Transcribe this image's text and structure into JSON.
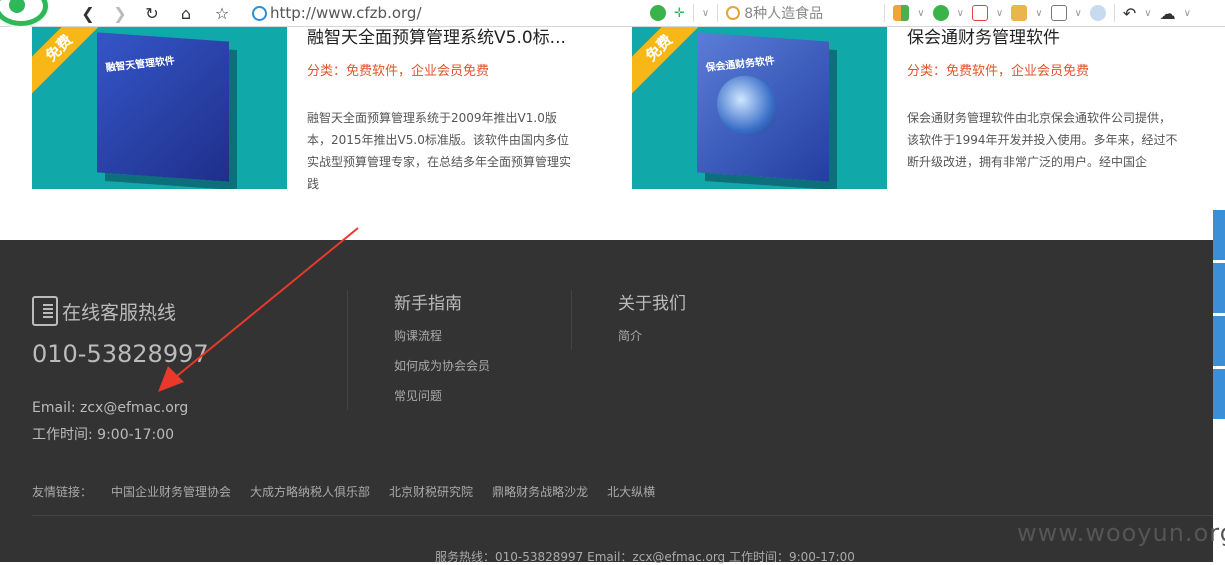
{
  "browser": {
    "url": "http://www.cfzb.org/",
    "search_text": "8种人造食品",
    "icons": [
      "back-icon",
      "forward-icon",
      "refresh-icon",
      "home-icon",
      "star-icon",
      "globe-icon",
      "extension-icon",
      "shield-icon",
      "pdf-icon",
      "translate-icon",
      "image-icon",
      "search-tool-icon",
      "undo-icon",
      "cloud-icon"
    ]
  },
  "products": [
    {
      "badge": "免费",
      "book_title": "融智天管理软件",
      "title": "融智天全面预算管理系统V5.0标...",
      "category": "分类：免费软件，企业会员免费",
      "description": "融智天全面预算管理系统于2009年推出V1.0版本，2015年推出V5.0标准版。该软件由国内多位实战型预算管理专家，在总结多年全面预算管理实践"
    },
    {
      "badge": "免费",
      "book_title": "保会通财务软件",
      "title": "保会通财务管理软件",
      "category": "分类：免费软件，企业会员免费",
      "description": "保会通财务管理软件由北京保会通软件公司提供，该软件于1994年开发并投入使用。多年来，经过不断升级改进，拥有非常广泛的用户。经中国企"
    }
  ],
  "footer": {
    "hotline_title": "在线客服热线",
    "hotline_number": "010-53828997",
    "email": "Email: zcx@efmac.org",
    "hours": "工作时间: 9:00-17:00",
    "guide_title": "新手指南",
    "guide_links": [
      "购课流程",
      "如何成为协会会员",
      "常见问题"
    ],
    "about_title": "关于我们",
    "about_links": [
      "简介"
    ],
    "friend_label": "友情链接：",
    "friend_links": [
      "中国企业财务管理协会",
      "大成方略纳税人俱乐部",
      "北京财税研究院",
      "鼎略财务战略沙龙",
      "北大纵横"
    ],
    "bottom_line": "服务热线：010-53828997 Email：zcx@efmac.org 工作时间：9:00-17:00",
    "watermark": "www.wooyun.org"
  },
  "colors": {
    "footer_bg": "#333333",
    "accent_red": "#e0542b",
    "card_teal": "#10a8a8",
    "badge_yellow": "#f6b717",
    "annotation_arrow": "#e8392a"
  }
}
